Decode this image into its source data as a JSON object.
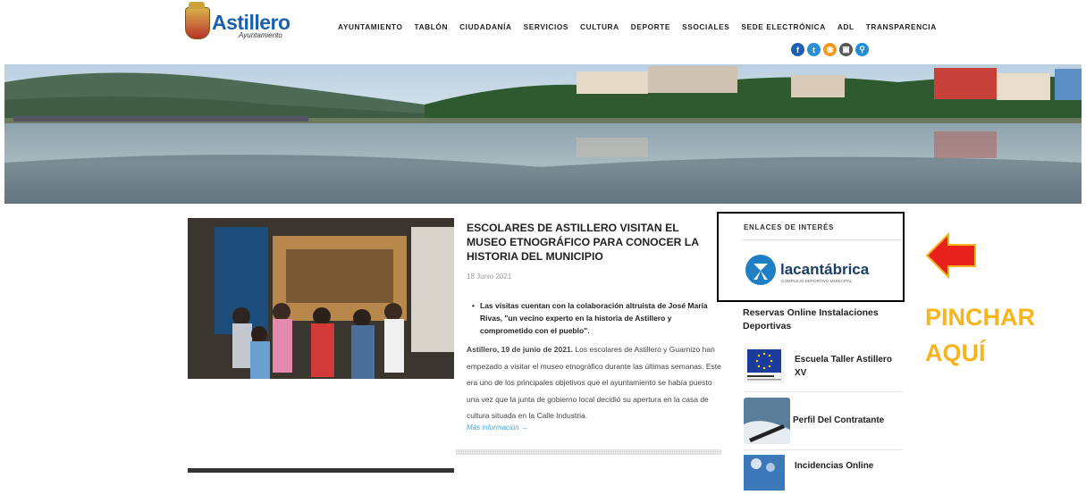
{
  "header": {
    "logo_text": "Astillero",
    "logo_sub": "Ayuntamiento",
    "nav": [
      "AYUNTAMIENTO",
      "TABLÓN",
      "CIUDADANÍA",
      "SERVICIOS",
      "CULTURA",
      "DEPORTE",
      "SSOCIALES",
      "SEDE ELECTRÓNICA",
      "ADL",
      "TRANSPARENCIA"
    ],
    "social_icons": [
      {
        "name": "facebook-icon",
        "glyph": "f",
        "color": "#1d5fb0"
      },
      {
        "name": "twitter-icon",
        "glyph": "t",
        "color": "#2c8fd6"
      },
      {
        "name": "rss-icon",
        "glyph": "◉",
        "color": "#f39a1e"
      },
      {
        "name": "lock-icon",
        "glyph": "▣",
        "color": "#555555"
      },
      {
        "name": "search-icon",
        "glyph": "⚲",
        "color": "#1d8fd9"
      }
    ]
  },
  "article": {
    "title": "ESCOLARES DE ASTILLERO VISITAN EL MUSEO ETNOGRÁFICO PARA CONOCER LA HISTORIA DEL MUNICIPIO",
    "date": "18 Junio 2021",
    "bullet": "Las visitas cuentan con la colaboración altruista de José María Rivas, \"un vecino experto en la historia de Astillero y comprometido con el pueblo\".",
    "lead_bold": "Astillero, 19 de junio de 2021.",
    "lead_text": " Los escolares de Astillero y Guarnizo han empezado a visitar el museo etnográfico durante las últimas semanas. Este era uno de los principales objetivos que el ayuntamiento se había puesto una vez que la junta de gobierno local decidió su apertura en la casa de cultura situada en la Calle Industria.",
    "more_link": "Más información →"
  },
  "sidebar": {
    "box_title": "ENLACES DE INTERÉS",
    "lacantabrica_text": "lacantábrica",
    "lacantabrica_sub": "COMPLEJO DEPORTIVO MUNICIPAL",
    "reservas_label": "Reservas Online Instalaciones Deportivas",
    "items": [
      {
        "label": "Escuela Taller Astillero XV"
      },
      {
        "label": "Perfil Del Contratante",
        "img_text": "Perfil del Contratante"
      },
      {
        "label": "Incidencias Online"
      }
    ]
  },
  "annotation": {
    "text_line1": "PINCHAR",
    "text_line2": "AQUÍ",
    "color": "#f6b51f",
    "arrow_color": "#e8211c"
  }
}
